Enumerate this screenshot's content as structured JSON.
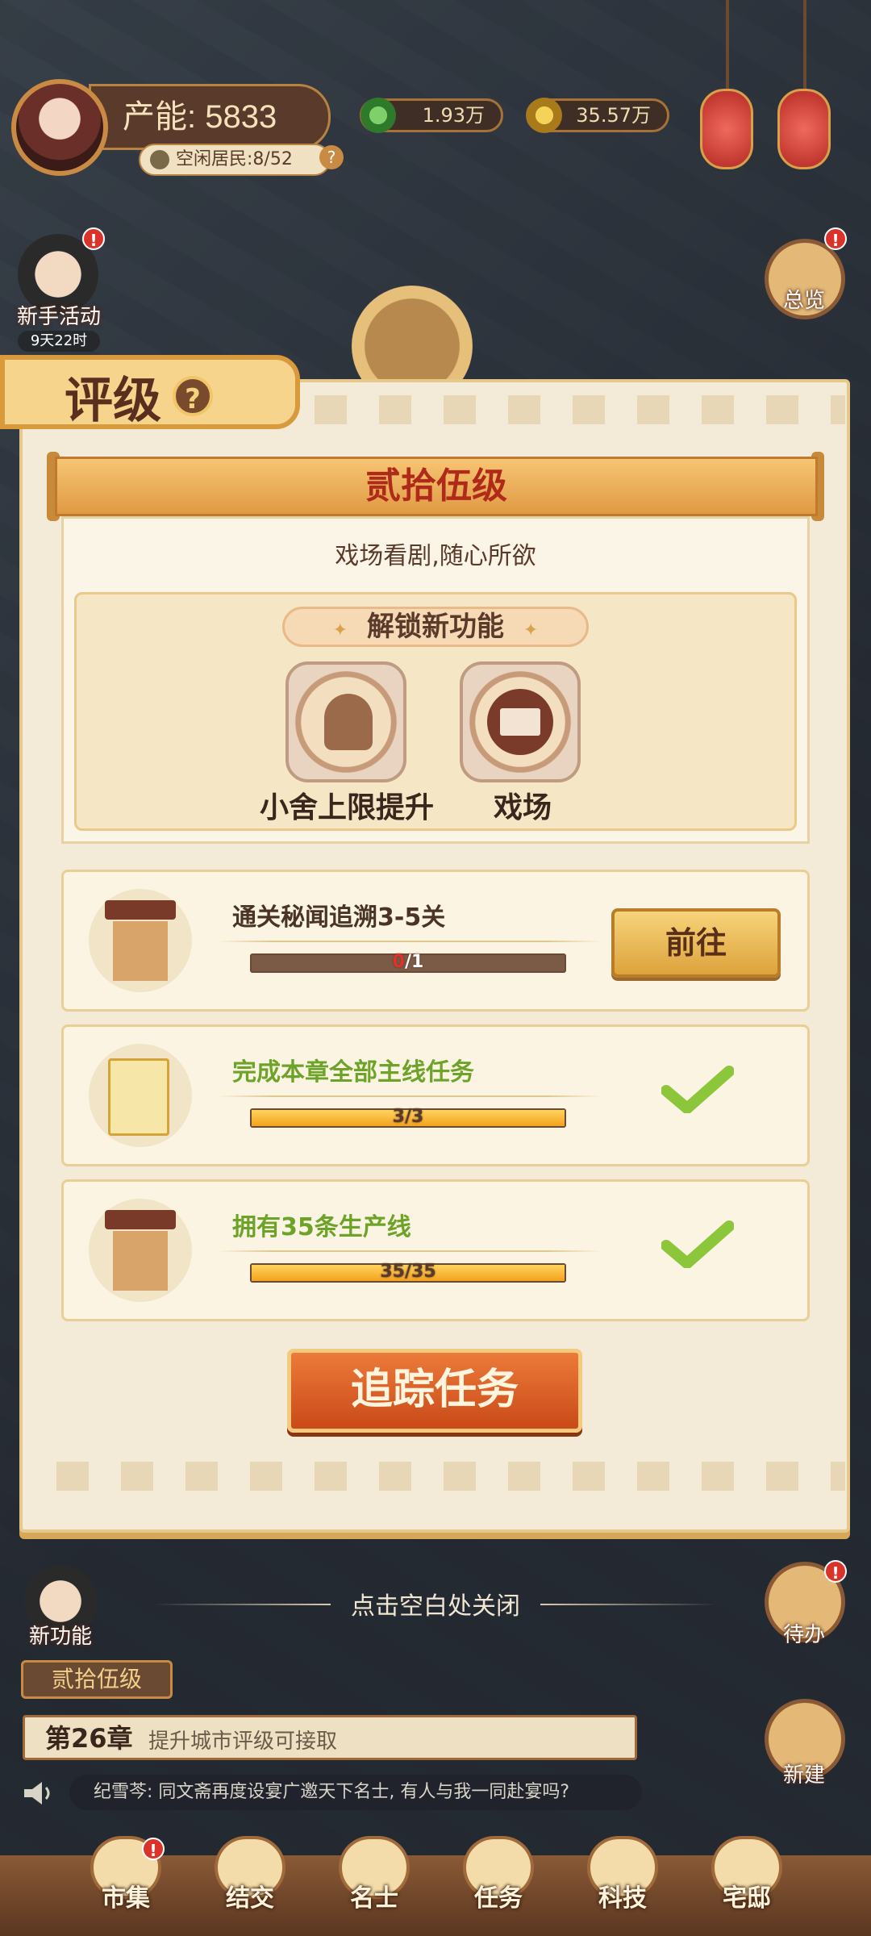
{
  "hud": {
    "capacity": "产能: 5833",
    "idle_residents": "空闲居民:8/52",
    "help": "?",
    "currency_green": "1.93万",
    "currency_gold": "35.57万"
  },
  "side_left": {
    "event_label": "新手活动",
    "event_timer": "9天22时",
    "new_feature_label": "新功能",
    "badge": "!"
  },
  "side_right": {
    "overview_label": "总览",
    "todo_label": "待办",
    "build_label": "新建",
    "badge": "!"
  },
  "panel": {
    "tab_title": "评级",
    "tab_help": "?",
    "level_title": "贰拾伍级",
    "level_subtitle": "戏场看剧,随心所欲",
    "unlock_label": "解锁新功能",
    "features": [
      {
        "label": "小舍上限提升",
        "icon": "worker-icon"
      },
      {
        "label": "戏场",
        "icon": "envelope-icon"
      }
    ],
    "tasks": [
      {
        "title": "通关秘闻追溯3-5关",
        "current": "0",
        "total": "1",
        "progress": 0.0,
        "done": false,
        "action": "前往",
        "icon": "pavilion-icon"
      },
      {
        "title": "完成本章全部主线任务",
        "current": "3",
        "total": "3",
        "progress": 1.0,
        "done": true,
        "icon": "document-icon"
      },
      {
        "title": "拥有35条生产线",
        "current": "35",
        "total": "35",
        "progress": 1.0,
        "done": true,
        "icon": "pavilion-icon"
      }
    ],
    "track_button": "追踪任务"
  },
  "close_hint": "点击空白处关闭",
  "bottom": {
    "level_pill": "贰拾伍级",
    "chapter_num": "第26章",
    "chapter_text": "提升城市评级可接取",
    "ticker": "纪雪芩: 同文斋再度设宴广邀天下名士, 有人与我一同赴宴吗?"
  },
  "nav": [
    {
      "label": "市集",
      "badge": true
    },
    {
      "label": "结交",
      "badge": false
    },
    {
      "label": "名士",
      "badge": false
    },
    {
      "label": "任务",
      "badge": false
    },
    {
      "label": "科技",
      "badge": false
    },
    {
      "label": "宅邸",
      "badge": false
    }
  ],
  "colors": {
    "accent_orange": "#c94a18",
    "done_green": "#6ea32a",
    "progress_fill": "#f3a21e",
    "alert_red": "#d9332a"
  }
}
